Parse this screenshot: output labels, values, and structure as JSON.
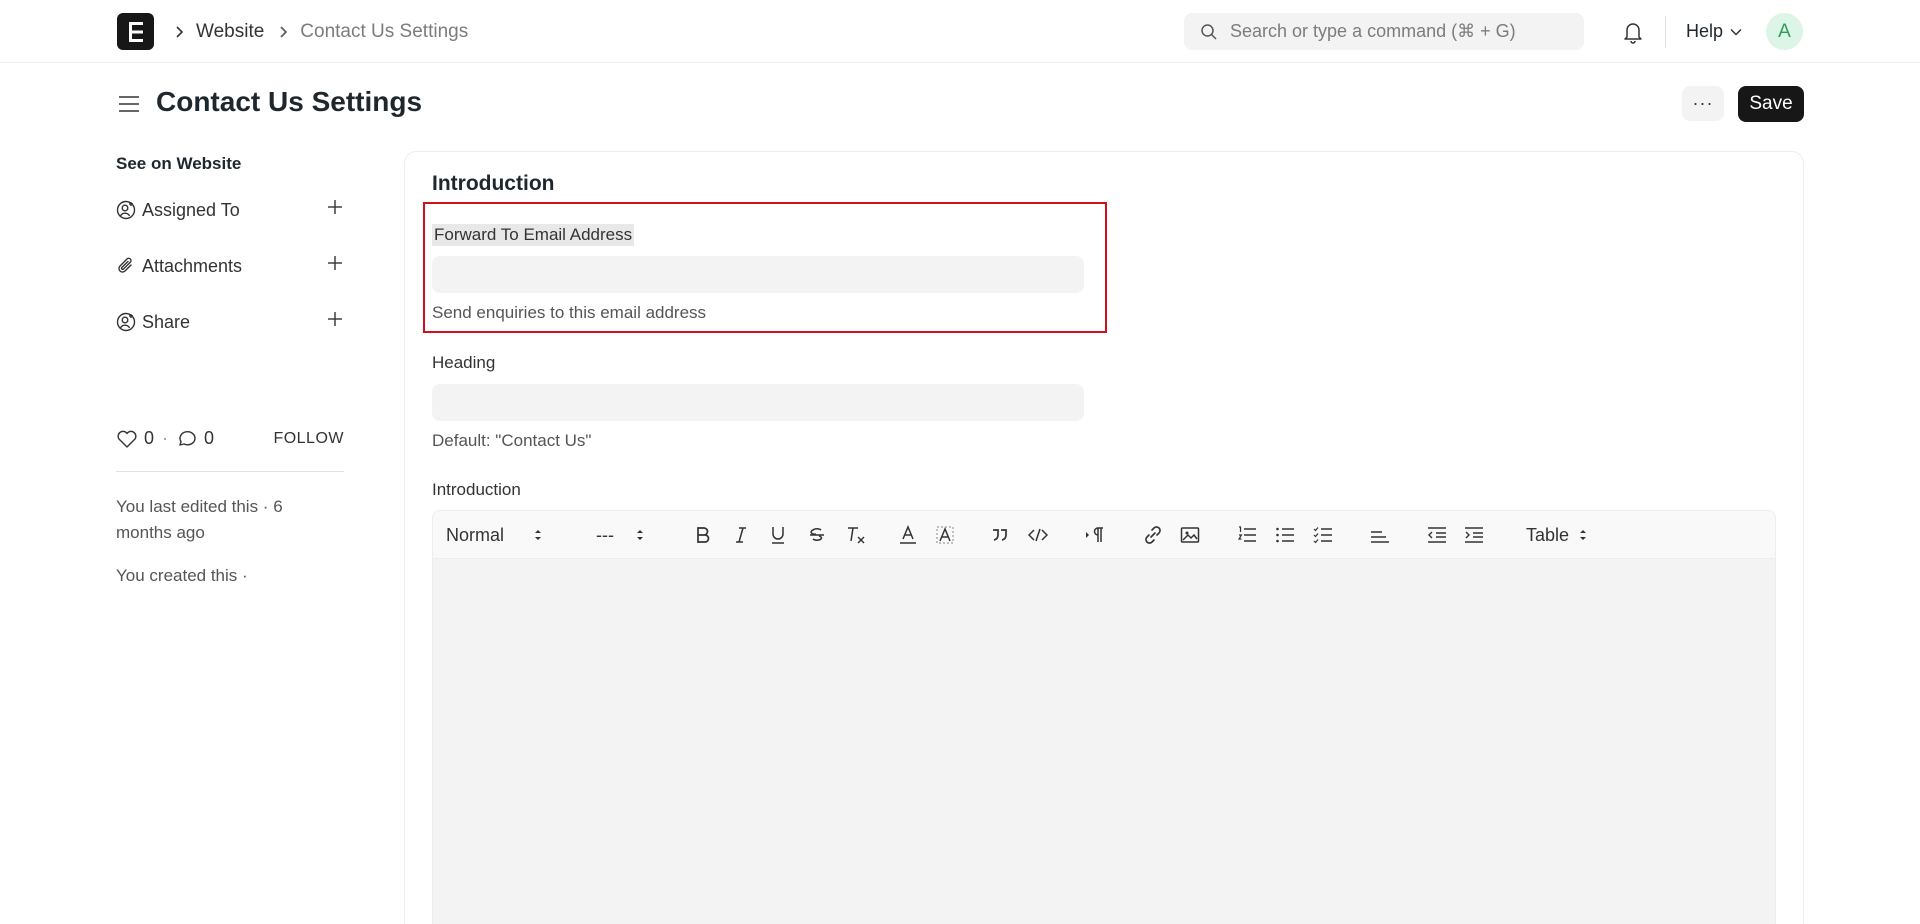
{
  "navbar": {
    "breadcrumbs": [
      "Website",
      "Contact Us Settings"
    ],
    "search_placeholder": "Search or type a command (⌘ + G)",
    "help_label": "Help",
    "avatar_initial": "A"
  },
  "page": {
    "title": "Contact Us Settings",
    "more_label": "···",
    "save_label": "Save"
  },
  "sidebar": {
    "see_on_website": "See on Website",
    "items": [
      {
        "label": "Assigned To",
        "icon": "user-plus-icon"
      },
      {
        "label": "Attachments",
        "icon": "paperclip-icon"
      },
      {
        "label": "Share",
        "icon": "user-plus-icon"
      }
    ],
    "likes": "0",
    "comments": "0",
    "stat_separator": "·",
    "follow_label": "FOLLOW",
    "last_edited": "You last edited this · 6 months ago",
    "created": "You created this ·"
  },
  "form": {
    "section_title": "Introduction",
    "fields": [
      {
        "label": "Forward To Email Address",
        "value": "",
        "help": "Send enquiries to this email address"
      },
      {
        "label": "Heading",
        "value": "",
        "help": "Default: \"Contact Us\""
      }
    ],
    "editor_label": "Introduction",
    "toolbar": {
      "heading_select": "Normal",
      "font_select": "---",
      "table_select": "Table"
    }
  },
  "colors": {
    "accent_dark": "#171717",
    "focus_outline": "#d0101b",
    "avatar_bg": "#dcf5e6",
    "avatar_fg": "#2e9e5c"
  }
}
